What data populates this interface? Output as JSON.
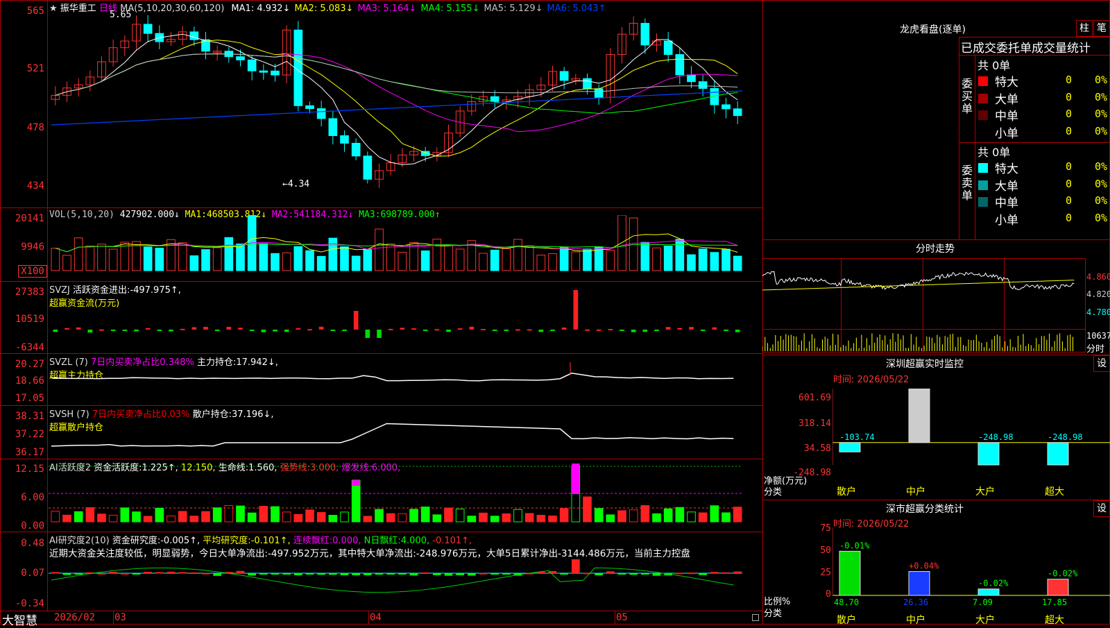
{
  "header": {
    "star": "★",
    "stock": "振华重工",
    "period": "日线",
    "ma_label": "MA(5,10,20,30,60,120)",
    "ma": [
      {
        "k": "MA1:",
        "v": "4.932↓",
        "c": "#ffffff"
      },
      {
        "k": "MA2:",
        "v": "5.083↓",
        "c": "#ffff00"
      },
      {
        "k": "MA3:",
        "v": "5.164↓",
        "c": "#ff00ff"
      },
      {
        "k": "MA4:",
        "v": "5.155↓",
        "c": "#00ff00"
      },
      {
        "k": "MA5:",
        "v": "5.129↓",
        "c": "#c0c0c0"
      },
      {
        "k": "MA6:",
        "v": "5.043↑",
        "c": "#0040ff"
      }
    ],
    "high_mark": "5.65",
    "low_mark": "4.34"
  },
  "price_axis": [
    "565",
    "521",
    "478",
    "434"
  ],
  "vol": {
    "label": "VOL(5,10,20)",
    "v": "427902.000↓",
    "ma1": "468503.812↓",
    "ma2": "541184.312↓",
    "ma3": "698789.000↑",
    "axis": [
      "20141",
      "9946",
      "X100"
    ]
  },
  "svzj": {
    "label": "SVZJ",
    "t1": "活跃资金进出:",
    "v1": "-497.975↑,",
    "t2": "超赢资金流(万元)",
    "axis": [
      "27383",
      "10519",
      "-6344"
    ]
  },
  "svzl": {
    "label": "SVZL (7)",
    "t1": "7日内买卖净占比0.348%",
    "t2": "主力持仓:",
    "v2": "17.942↓,",
    "t3": "超赢主力持仓",
    "axis": [
      "20.27",
      "18.66",
      "17.05"
    ]
  },
  "svsh": {
    "label": "SVSH (7)",
    "t1": "7日内买卖净占比0.03%",
    "t2": "散户持仓:",
    "v2": "37.196↓,",
    "t3": "超赢散户持仓",
    "axis": [
      "38.31",
      "37.22",
      "36.17"
    ]
  },
  "ai1": {
    "label": "AI活跃度2",
    "t1": "资金活跃度:",
    "v1": "1.225↑,",
    "v2": "12.150,",
    "t3": "生命线:",
    "v3": "1.560,",
    "t4": "强势线:",
    "v4": "3.000,",
    "t5": "爆发线:",
    "v5": "6.000,",
    "axis": [
      "12.15",
      "6.00",
      "0.00"
    ]
  },
  "ai2": {
    "label": "AI研究度2(10)",
    "t1": "资金研究度:",
    "v1": "-0.005↑,",
    "t2": "平均研究度:",
    "v2": "-0.101↑,",
    "t3": "连续飘红:",
    "v3": "0.000,",
    "t4": "N日飘红:",
    "v4": "4.000,",
    "v5": "-0.101↑,",
    "comment": "近期大资金关注度较低，明显弱势，今日大单净流出:-497.952万元，其中特大单净流出:-248.976万元，大单5日累计净出-3144.486万元，当前主力控盘",
    "axis": [
      "0.48",
      "0.07",
      "-0.34"
    ]
  },
  "xaxis": {
    "brand": "大智慧",
    "labels": [
      "2026/02",
      "03",
      "04",
      "05"
    ]
  },
  "longhu": {
    "title": "龙虎看盘(逐单)",
    "btn1": "柱",
    "btn2": "笔",
    "subtitle": "已成交委托单成交量统计",
    "buy": {
      "side": "委买单",
      "total": "共 0单",
      "rows": [
        {
          "n": "特大",
          "v": "0",
          "p": "0%",
          "c": "#ff0000"
        },
        {
          "n": "大单",
          "v": "0",
          "p": "0%",
          "c": "#a00000"
        },
        {
          "n": "中单",
          "v": "0",
          "p": "0%",
          "c": "#600000"
        },
        {
          "n": "小单",
          "v": "0",
          "p": "0%",
          "c": ""
        }
      ]
    },
    "sell": {
      "side": "委卖单",
      "total": "共 0单",
      "rows": [
        {
          "n": "特大",
          "v": "0",
          "p": "0%",
          "c": "#00ffff"
        },
        {
          "n": "大单",
          "v": "0",
          "p": "0%",
          "c": "#00a0a0"
        },
        {
          "n": "中单",
          "v": "0",
          "p": "0%",
          "c": "#006868"
        },
        {
          "n": "小单",
          "v": "0",
          "p": "0%",
          "c": ""
        }
      ]
    }
  },
  "fenshi": {
    "title": "分时走势",
    "axis": [
      "4.860",
      "4.820",
      "4.780"
    ],
    "vol": "10637",
    "label": "分时"
  },
  "sz_monitor": {
    "title": "深圳超赢实时监控",
    "btn": "设",
    "time": "时间: 2026/05/22",
    "axis": [
      "601.69",
      "318.14",
      "34.58",
      "-248.98"
    ],
    "ylab1": "净额(万元)",
    "ylab2": "分类",
    "cats": [
      "散户",
      "中户",
      "大户",
      "超大"
    ],
    "vals": [
      "-103.74",
      "601.69",
      "-248.98",
      "-248.98"
    ]
  },
  "sz_class": {
    "title": "深市超赢分类统计",
    "btn": "设",
    "time": "时间: 2026/05/22",
    "axis": [
      "75",
      "50",
      "25",
      "0"
    ],
    "ylab1": "比例%",
    "ylab2": "分类",
    "cats": [
      "散户",
      "中户",
      "大户",
      "超大"
    ],
    "vals": [
      "48.70",
      "26.36",
      "7.09",
      "17.85"
    ],
    "deltas": [
      "-0.01%",
      "+0.04%",
      "-0.02%",
      "-0.02%"
    ]
  },
  "chart_data": {
    "type": "candlestick",
    "title": "振华重工 日线",
    "price_range": [
      4.34,
      5.65
    ],
    "high": 5.65,
    "low": 4.34,
    "x_labels": [
      "2026/02",
      "03",
      "04",
      "05"
    ],
    "sz_monitor_bar": {
      "type": "bar",
      "categories": [
        "散户",
        "中户",
        "大户",
        "超大"
      ],
      "values": [
        -103.74,
        601.69,
        -248.98,
        -248.98
      ]
    },
    "sz_class_bar": {
      "type": "bar",
      "categories": [
        "散户",
        "中户",
        "大户",
        "超大"
      ],
      "values": [
        48.7,
        26.36,
        7.09,
        17.85
      ]
    }
  }
}
